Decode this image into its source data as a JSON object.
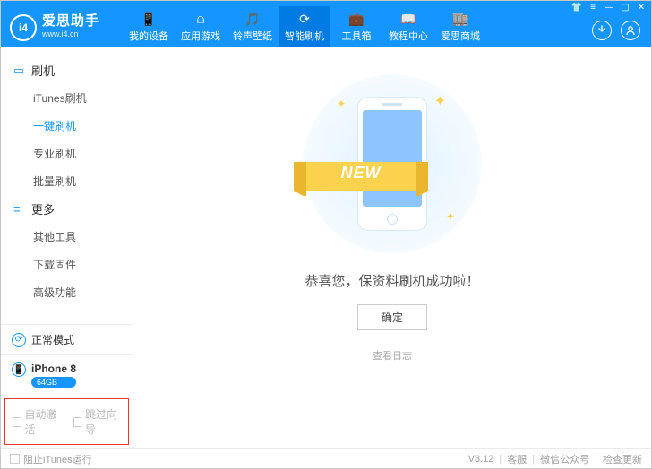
{
  "brand": {
    "logo_text": "i4",
    "title": "爱思助手",
    "sub": "www.i4.cn"
  },
  "nav": [
    {
      "icon": "📱",
      "label": "我的设备",
      "name": "nav-my-device"
    },
    {
      "icon": "⩍",
      "label": "应用游戏",
      "name": "nav-apps"
    },
    {
      "icon": "🎵",
      "label": "铃声壁纸",
      "name": "nav-ringtone"
    },
    {
      "icon": "⟳",
      "label": "智能刷机",
      "name": "nav-flash",
      "active": true
    },
    {
      "icon": "💼",
      "label": "工具箱",
      "name": "nav-toolbox"
    },
    {
      "icon": "📖",
      "label": "教程中心",
      "name": "nav-tutorial"
    },
    {
      "icon": "🏬",
      "label": "爱思商城",
      "name": "nav-store"
    }
  ],
  "sidebar": {
    "groups": [
      {
        "icon": "▭",
        "title": "刷机",
        "items": [
          {
            "label": "iTunes刷机",
            "name": "side-itunes-flash"
          },
          {
            "label": "一键刷机",
            "name": "side-onekey-flash",
            "active": true
          },
          {
            "label": "专业刷机",
            "name": "side-pro-flash"
          },
          {
            "label": "批量刷机",
            "name": "side-batch-flash"
          }
        ]
      },
      {
        "icon": "≡",
        "title": "更多",
        "items": [
          {
            "label": "其他工具",
            "name": "side-other-tools"
          },
          {
            "label": "下载固件",
            "name": "side-download-fw"
          },
          {
            "label": "高级功能",
            "name": "side-advanced"
          }
        ]
      }
    ],
    "status": {
      "mode_label": "正常模式",
      "device_label": "iPhone 8",
      "storage_badge": "64GB"
    },
    "options": {
      "auto_activate": "自动激活",
      "skip_guide": "跳过向导"
    }
  },
  "main": {
    "ribbon": "NEW",
    "message": "恭喜您，保资料刷机成功啦！",
    "ok_label": "确定",
    "log_label": "查看日志"
  },
  "footer": {
    "block_itunes": "阻止iTunes运行",
    "version": "V8.12",
    "support": "客服",
    "wechat": "微信公众号",
    "update": "检查更新"
  }
}
